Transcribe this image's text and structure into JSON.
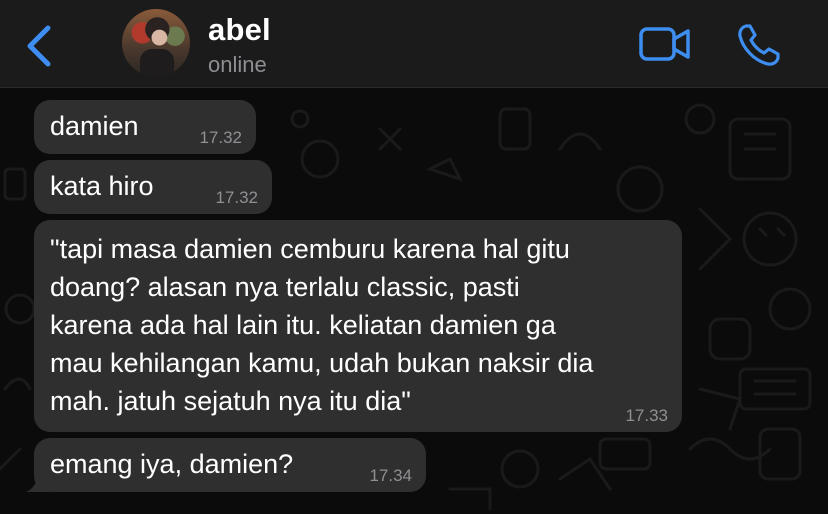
{
  "header": {
    "contact_name": "abel",
    "status": "online",
    "icons": {
      "back": "chevron-left-icon",
      "video": "video-call-icon",
      "phone": "phone-call-icon"
    },
    "accent_color": "#3d8ef0"
  },
  "messages": [
    {
      "text": "damien",
      "time": "17.32"
    },
    {
      "text": "kata hiro",
      "time": "17.32"
    },
    {
      "lines": [
        "\"tapi masa damien cemburu karena hal gitu",
        "doang? alasan nya terlalu classic, pasti",
        "karena ada hal lain itu. keliatan damien ga",
        "mau kehilangan kamu, udah bukan naksir dia",
        "mah. jatuh sejatuh nya itu dia\""
      ],
      "time": "17.33"
    },
    {
      "text": "emang iya, damien?",
      "time": "17.34"
    }
  ],
  "colors": {
    "background": "#0b0b0b",
    "header": "#1b1b1b",
    "bubble": "#2f2f2f",
    "timestamp": "#8f8f94"
  }
}
